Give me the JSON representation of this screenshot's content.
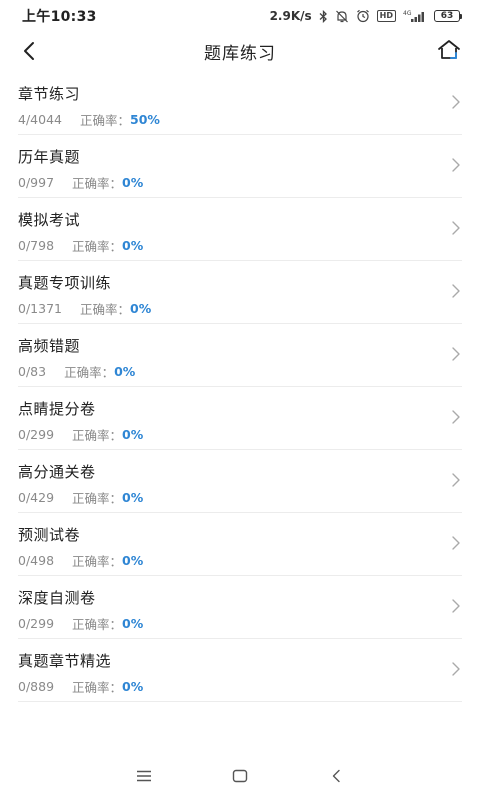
{
  "status_bar": {
    "time": "上午10:33",
    "network_speed": "2.9K/s",
    "hd_label": "HD",
    "signal_label": "4G",
    "battery_level": "63"
  },
  "header": {
    "title": "题库练习",
    "back_icon": "chevron-left-icon",
    "home_icon": "home-icon"
  },
  "rate_label": "正确率：",
  "items": [
    {
      "title": "章节练习",
      "count": "4/4044",
      "rate": "50%"
    },
    {
      "title": "历年真题",
      "count": "0/997",
      "rate": "0%"
    },
    {
      "title": "模拟考试",
      "count": "0/798",
      "rate": "0%"
    },
    {
      "title": "真题专项训练",
      "count": "0/1371",
      "rate": "0%"
    },
    {
      "title": "高频错题",
      "count": "0/83",
      "rate": "0%"
    },
    {
      "title": "点睛提分卷",
      "count": "0/299",
      "rate": "0%"
    },
    {
      "title": "高分通关卷",
      "count": "0/429",
      "rate": "0%"
    },
    {
      "title": "预测试卷",
      "count": "0/498",
      "rate": "0%"
    },
    {
      "title": "深度自测卷",
      "count": "0/299",
      "rate": "0%"
    },
    {
      "title": "真题章节精选",
      "count": "0/889",
      "rate": "0%"
    }
  ],
  "colors": {
    "accent": "#2f86d4",
    "home_accent": "#2f86d4"
  }
}
